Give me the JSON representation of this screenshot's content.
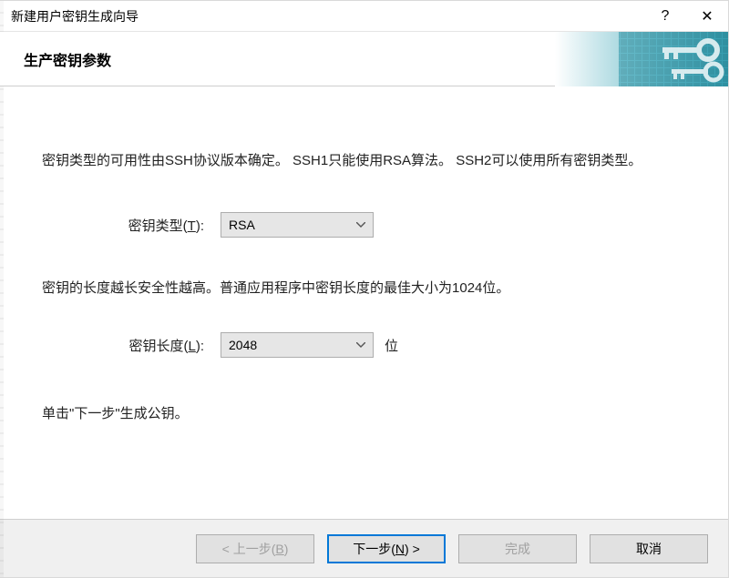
{
  "titlebar": {
    "title": "新建用户密钥生成向导",
    "help": "?",
    "close": "✕"
  },
  "banner": {
    "title": "生产密钥参数"
  },
  "body": {
    "p1": "密钥类型的可用性由SSH协议版本确定。 SSH1只能使用RSA算法。 SSH2可以使用所有密钥类型。",
    "type_label_pre": "密钥类型(",
    "type_label_u": "T",
    "type_label_post": "):",
    "type_value": "RSA",
    "p2": "密钥的长度越长安全性越高。普通应用程序中密钥长度的最佳大小为1024位。",
    "len_label_pre": "密钥长度(",
    "len_label_u": "L",
    "len_label_post": "):",
    "len_value": "2048",
    "len_unit": "位",
    "p3": "单击\"下一步\"生成公钥。"
  },
  "footer": {
    "back_pre": "< 上一步(",
    "back_u": "B",
    "back_post": ")",
    "next_pre": "下一步(",
    "next_u": "N",
    "next_post": ") >",
    "finish": "完成",
    "cancel": "取消"
  },
  "icons": {
    "caret": "chevron-down"
  }
}
